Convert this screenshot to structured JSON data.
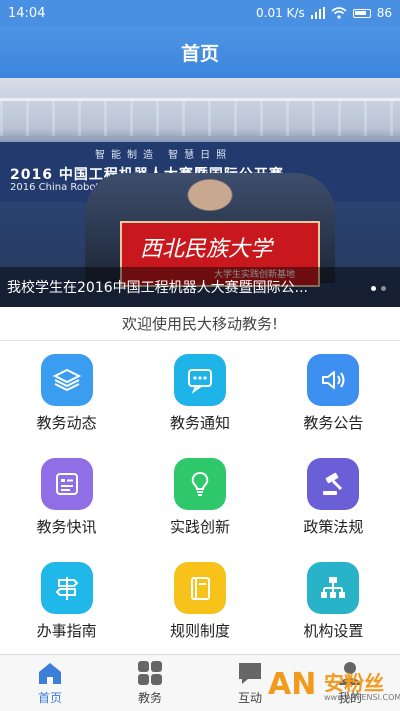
{
  "status_bar": {
    "time": "14:04",
    "speed": "0.01 K/s",
    "battery": "86"
  },
  "header": {
    "title": "首页"
  },
  "banner": {
    "sign_top": "智能制造 智慧日照",
    "sign_cn": "2016 中国工程机器人大赛暨国际公开赛",
    "sign_en": "2016 China Robot Competition and International Open",
    "flag_big": "西北民族大学",
    "flag_small": "大学生实践创新基地",
    "caption": "我校学生在2016中国工程机器人大赛暨国际公..."
  },
  "welcome": "欢迎使用民大移动教务!",
  "grid": [
    {
      "label": "教务动态",
      "icon": "layers-icon",
      "color": "#3a9df0"
    },
    {
      "label": "教务通知",
      "icon": "message-icon",
      "color": "#1fb4e8"
    },
    {
      "label": "教务公告",
      "icon": "speaker-icon",
      "color": "#3d8ff0"
    },
    {
      "label": "教务快讯",
      "icon": "newsletter-icon",
      "color": "#8f6ee6"
    },
    {
      "label": "实践创新",
      "icon": "lightbulb-icon",
      "color": "#2ec86a"
    },
    {
      "label": "政策法规",
      "icon": "gavel-icon",
      "color": "#6a5fd6"
    },
    {
      "label": "办事指南",
      "icon": "signpost-icon",
      "color": "#1fb8e8"
    },
    {
      "label": "规则制度",
      "icon": "book-icon",
      "color": "#f7c21a"
    },
    {
      "label": "机构设置",
      "icon": "org-chart-icon",
      "color": "#29b3c9"
    }
  ],
  "tabs": [
    {
      "label": "首页",
      "icon": "home-icon"
    },
    {
      "label": "教务",
      "icon": "grid-icon"
    },
    {
      "label": "互动",
      "icon": "chat-icon"
    },
    {
      "label": "我的",
      "icon": "user-icon"
    }
  ],
  "watermark": {
    "brand": "安粉丝",
    "url": "www.ANFENSI.COM"
  }
}
